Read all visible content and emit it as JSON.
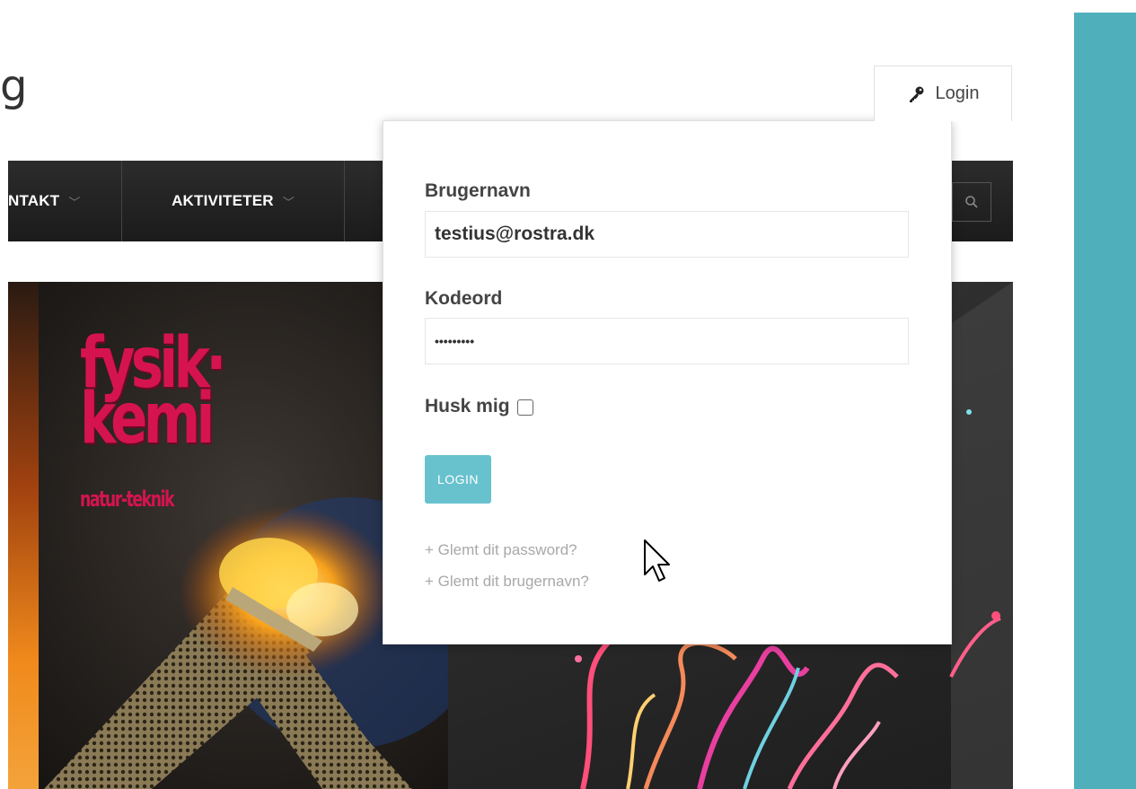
{
  "header": {
    "logo_fragment": "g",
    "login_label": "Login"
  },
  "nav": {
    "items": [
      {
        "label": "NTAKT"
      },
      {
        "label": "AKTIVITETER"
      }
    ]
  },
  "banner": {
    "book_title_line1": "fysik·",
    "book_title_line2": "kemi",
    "book_subtitle": "natur-teknik"
  },
  "login_form": {
    "username_label": "Brugernavn",
    "username_value": "testius@rostra.dk",
    "password_label": "Kodeord",
    "password_value": "•••••••••",
    "remember_label": "Husk mig",
    "remember_checked": false,
    "submit_label": "LOGIN",
    "forgot_password": "+ Glemt dit password?",
    "forgot_username": "+ Glemt dit brugernavn?"
  },
  "colors": {
    "accent": "#4fb0bc",
    "button": "#68c2ce",
    "nav_bg": "#222222",
    "book_red": "#d5144f"
  },
  "icons": {
    "login": "key-icon",
    "search": "search-icon",
    "chevron": "chevron-down-icon"
  }
}
